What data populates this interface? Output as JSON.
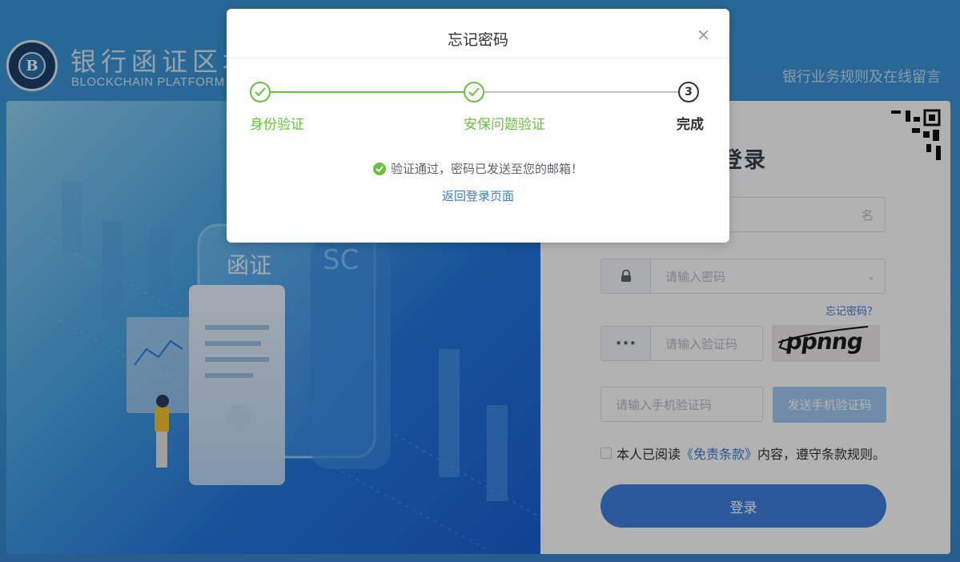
{
  "header": {
    "logo_cn": "银行函证区块",
    "logo_en": "BLOCKCHAIN PLATFORM F",
    "top_link": "银行业务规则及在线留言"
  },
  "illustration": {
    "document_text": "函证",
    "tag_text": "SC"
  },
  "login": {
    "title": "中登录",
    "username_placeholder_visible": "名",
    "password_placeholder": "请输入密码",
    "forgot_link": "忘记密码？",
    "captcha_placeholder": "请输入验证码",
    "captcha_text": "ppnng",
    "sms_placeholder": "请输入手机验证码",
    "sms_button": "发送手机验证码",
    "agree_prefix": "本人已阅读",
    "agree_link": "《免责条款》",
    "agree_suffix": "内容，遵守条款规则。",
    "submit": "登录"
  },
  "modal": {
    "title": "忘记密码",
    "close": "×",
    "steps": [
      {
        "label": "身份验证",
        "state": "done"
      },
      {
        "label": "安保问题验证",
        "state": "done"
      },
      {
        "label": "完成",
        "state": "current",
        "number": "3"
      }
    ],
    "message": "验证通过，密码已发送至您的邮箱！",
    "back_link": "返回登录页面"
  },
  "colors": {
    "success": "#67c23a",
    "link": "#3d7bd2",
    "primary": "#3d82dc"
  },
  "icons": [
    "lock-icon",
    "dots-icon",
    "check-icon",
    "close-icon",
    "qr-icon",
    "check-circle-icon"
  ]
}
